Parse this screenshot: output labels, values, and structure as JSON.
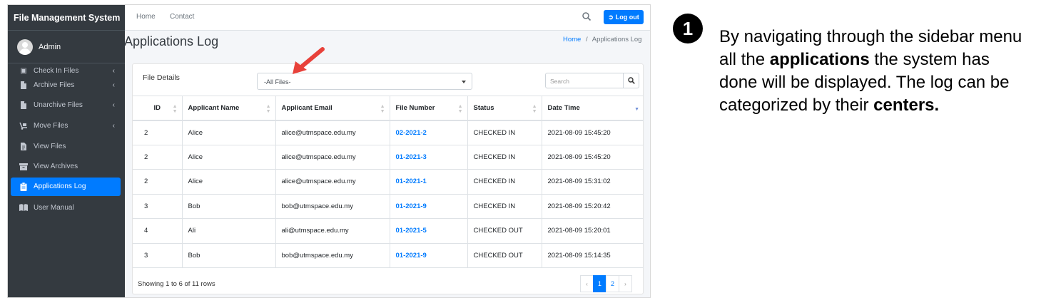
{
  "app": {
    "brand": "File Management System",
    "user": "Admin"
  },
  "sidebar": {
    "items": [
      {
        "label": "Check In Files",
        "icon": "checkin-icon",
        "chevron": true
      },
      {
        "label": "Archive Files",
        "icon": "file-icon",
        "chevron": true
      },
      {
        "label": "Unarchive Files",
        "icon": "file-icon",
        "chevron": true
      },
      {
        "label": "Move Files",
        "icon": "dolly-icon",
        "chevron": true
      },
      {
        "label": "View Files",
        "icon": "file-text-icon",
        "chevron": false
      },
      {
        "label": "View Archives",
        "icon": "archive-icon",
        "chevron": false
      },
      {
        "label": "Applications Log",
        "icon": "clipboard-icon",
        "chevron": false,
        "active": true
      },
      {
        "label": "User Manual",
        "icon": "book-icon",
        "chevron": false
      }
    ]
  },
  "topbar": {
    "home": "Home",
    "contact": "Contact",
    "logout": "Log out"
  },
  "page": {
    "title": "Applications Log",
    "breadcrumb_home": "Home",
    "breadcrumb_sep": "/",
    "breadcrumb_current": "Applications Log"
  },
  "card": {
    "label": "File Details",
    "filter_value": "-All Files-",
    "search_placeholder": "Search"
  },
  "table": {
    "columns": [
      "ID",
      "Applicant Name",
      "Applicant Email",
      "File Number",
      "Status",
      "Date Time"
    ],
    "rows": [
      [
        "2",
        "Alice",
        "alice@utmspace.edu.my",
        "02-2021-2",
        "CHECKED IN",
        "2021-08-09 15:45:20"
      ],
      [
        "2",
        "Alice",
        "alice@utmspace.edu.my",
        "01-2021-3",
        "CHECKED IN",
        "2021-08-09 15:45:20"
      ],
      [
        "2",
        "Alice",
        "alice@utmspace.edu.my",
        "01-2021-1",
        "CHECKED IN",
        "2021-08-09 15:31:02"
      ],
      [
        "3",
        "Bob",
        "bob@utmspace.edu.my",
        "01-2021-9",
        "CHECKED IN",
        "2021-08-09 15:20:42"
      ],
      [
        "4",
        "Ali",
        "ali@utmspace.edu.my",
        "01-2021-5",
        "CHECKED OUT",
        "2021-08-09 15:20:01"
      ],
      [
        "3",
        "Bob",
        "bob@utmspace.edu.my",
        "01-2021-9",
        "CHECKED OUT",
        "2021-08-09 15:14:35"
      ]
    ]
  },
  "footer": {
    "info": "Showing 1 to 6 of 11 rows",
    "prev": "‹",
    "page1": "1",
    "page2": "2",
    "next": "›"
  },
  "annotation": {
    "step": "1",
    "text_1": "By navigating through the sidebar menu all the ",
    "bold_1": "applications",
    "text_2": " the system has done will be displayed. The log can be categorized by their ",
    "bold_2": "centers."
  },
  "colors": {
    "accent": "#007bff",
    "sidebar_bg": "#343a40",
    "arrow": "#e8413a"
  }
}
